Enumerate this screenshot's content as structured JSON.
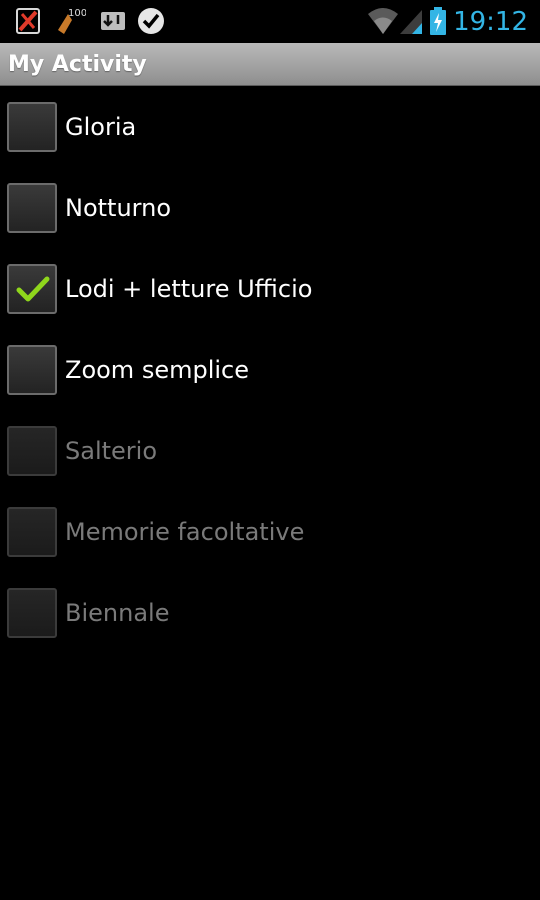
{
  "status_bar": {
    "icons_left": [
      "app-notification-icon",
      "badge-100-icon",
      "download-icon",
      "check-badge-icon"
    ],
    "badge_count": "100",
    "icons_right": [
      "wifi-icon",
      "signal-icon",
      "battery-charging-icon"
    ],
    "time": "19:12",
    "accent_color": "#33b5e5"
  },
  "title_bar": {
    "title": "My Activity"
  },
  "items": [
    {
      "label": "Gloria",
      "checked": false,
      "enabled": true
    },
    {
      "label": "Notturno",
      "checked": false,
      "enabled": true
    },
    {
      "label": "Lodi + letture Ufficio",
      "checked": true,
      "enabled": true
    },
    {
      "label": "Zoom semplice",
      "checked": false,
      "enabled": true
    },
    {
      "label": "Salterio",
      "checked": false,
      "enabled": false
    },
    {
      "label": "Memorie facoltative",
      "checked": false,
      "enabled": false
    },
    {
      "label": "Biennale",
      "checked": false,
      "enabled": false
    }
  ],
  "colors": {
    "check": "#8fd61c",
    "disabled_text": "#7a7a7a",
    "title_bar": "#a3a3a3"
  }
}
